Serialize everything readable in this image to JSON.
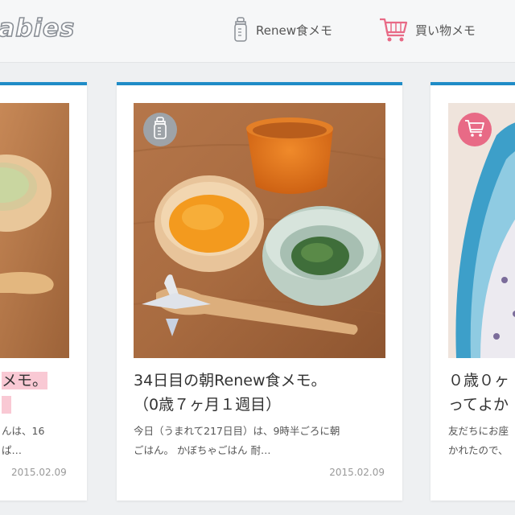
{
  "header": {
    "logo_text": "abies",
    "nav": [
      {
        "label": "Renew食メモ",
        "icon": "baby-bottle-icon"
      },
      {
        "label": "買い物メモ",
        "icon": "shopping-cart-icon"
      }
    ]
  },
  "colors": {
    "accent": "#1f8cc7",
    "highlight": "#f9c9d4",
    "shop_badge": "#e86a86",
    "renew_badge": "#9ea3a8"
  },
  "cards": [
    {
      "title_line1": "メモ。",
      "excerpt_line1": "んは、16",
      "excerpt_line2": "ぱ…",
      "date": "2015.02.09"
    },
    {
      "title_line1": "34日目の朝Renew食メモ。",
      "title_line2": "（0歳７ヶ月１週目）",
      "excerpt_line1": "今日（うまれて217日目）は、9時半ごろに朝",
      "excerpt_line2": "ごはん。 かぼちゃごはん 耐…",
      "date": "2015.02.09",
      "badge_icon": "baby-bottle-icon"
    },
    {
      "title_line1": "０歳０ヶ",
      "title_line2": "ってよか",
      "excerpt_line1": "友だちにお座",
      "excerpt_line2": "かれたので、",
      "badge_icon": "shopping-cart-icon"
    }
  ]
}
